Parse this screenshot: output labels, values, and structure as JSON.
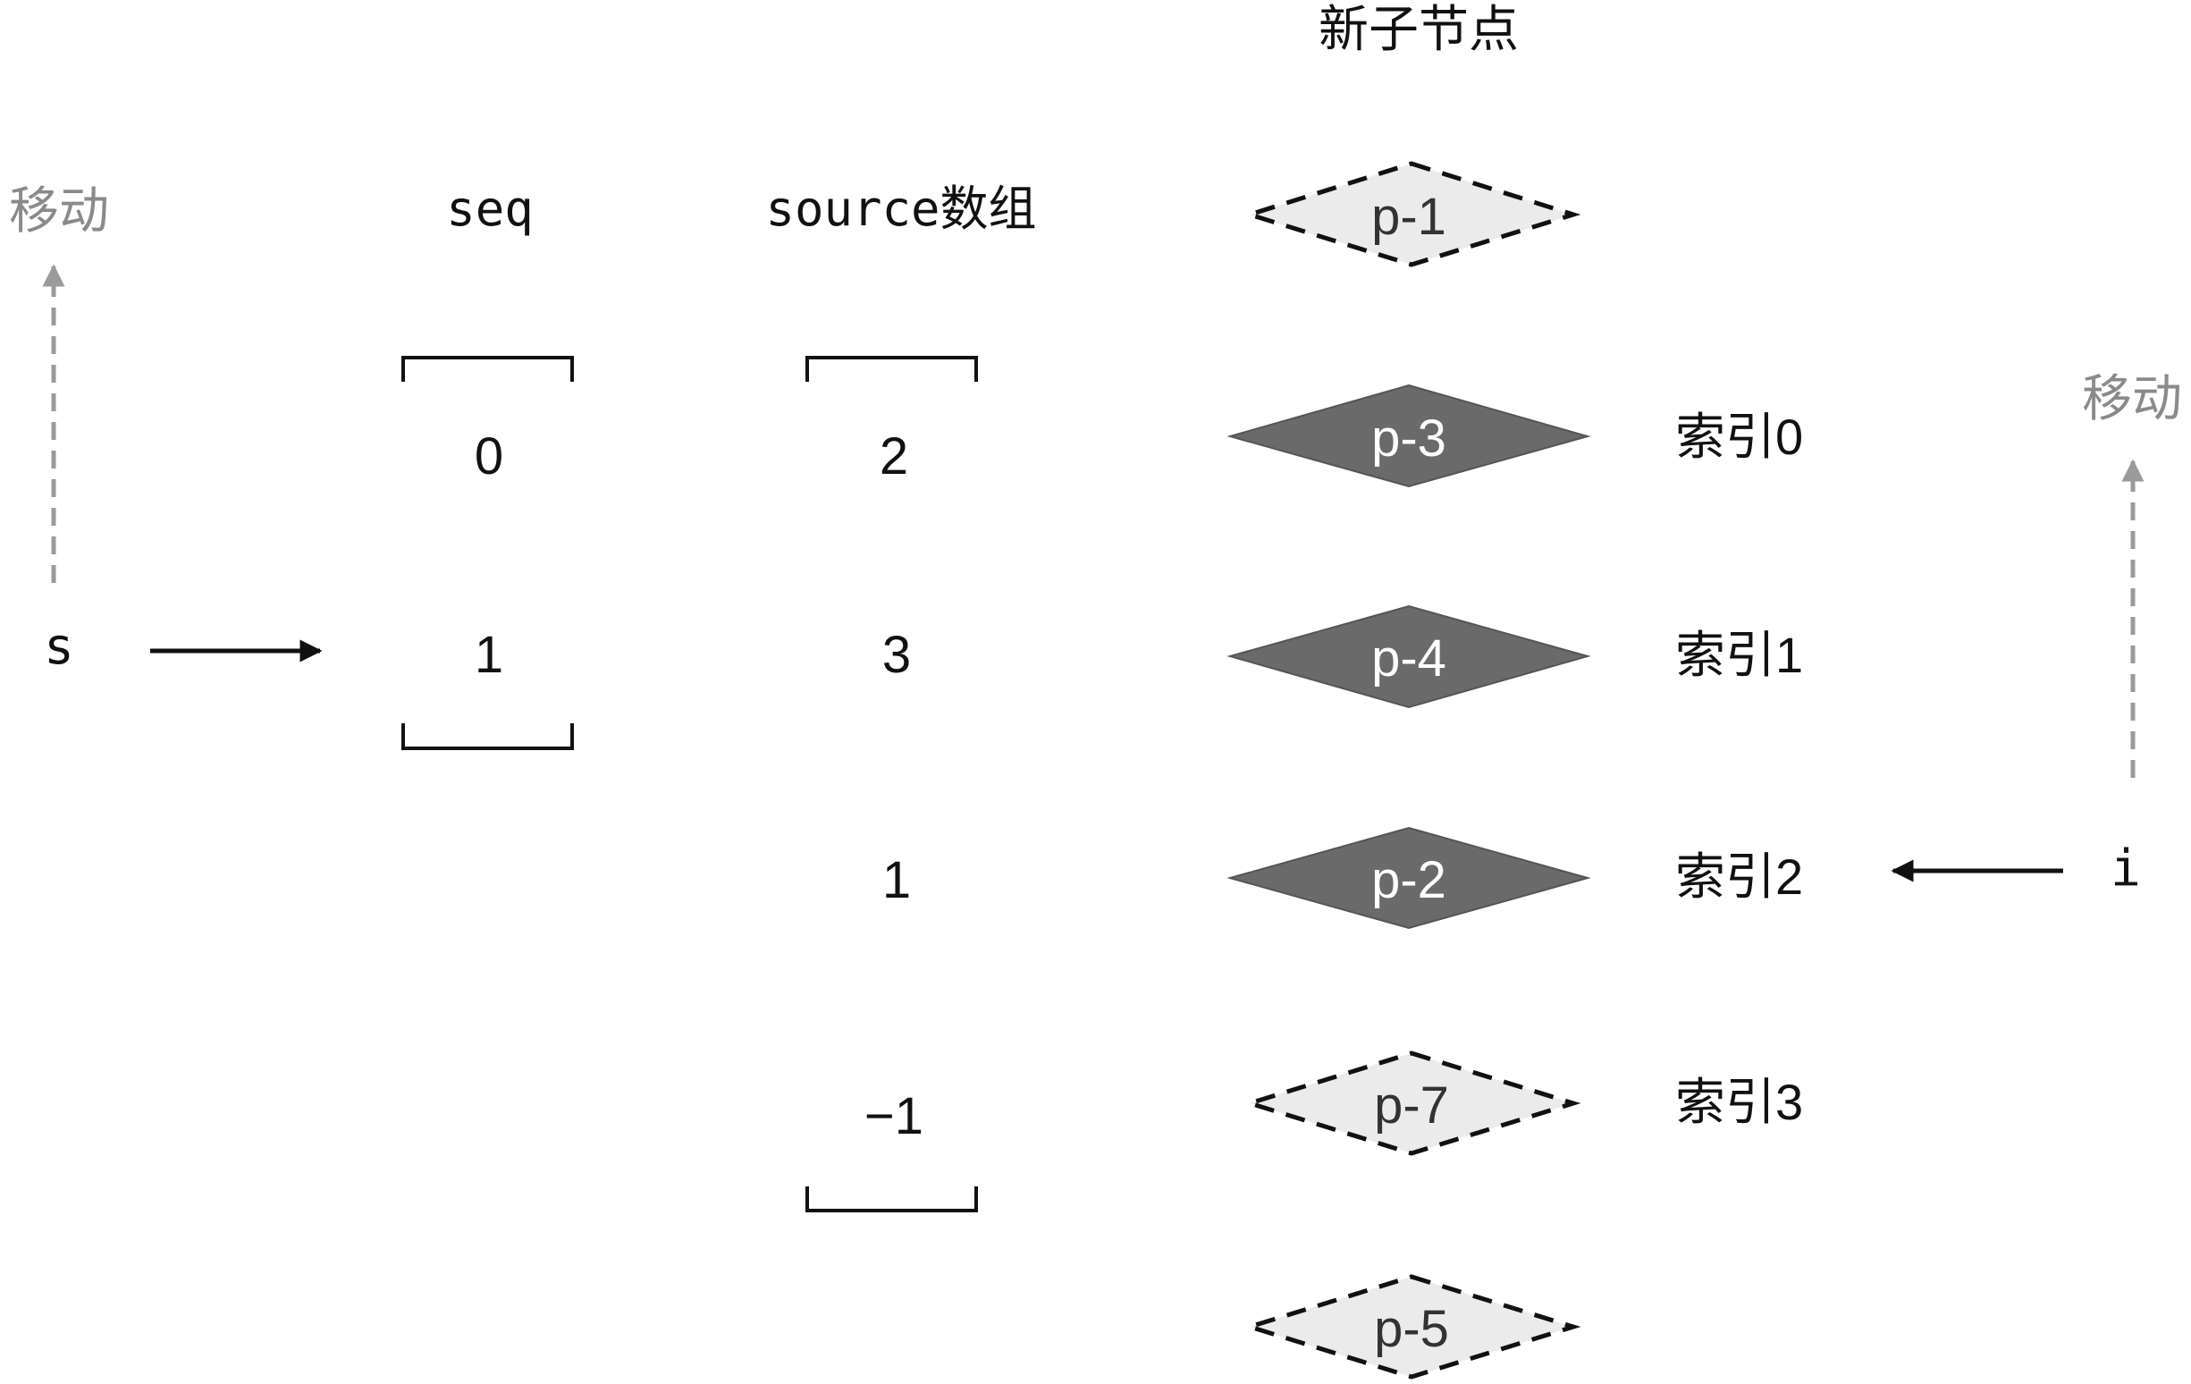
{
  "header": {
    "title": "新子节点"
  },
  "left": {
    "move_label": "移动",
    "pointer_label": "s",
    "seq_title": "seq",
    "seq_values": [
      "0",
      "1"
    ]
  },
  "source": {
    "title": "source数组",
    "values": [
      "2",
      "3",
      "1",
      "−1"
    ]
  },
  "nodes": [
    {
      "label": "p-1",
      "style": "dashed"
    },
    {
      "label": "p-3",
      "style": "solid"
    },
    {
      "label": "p-4",
      "style": "solid"
    },
    {
      "label": "p-2",
      "style": "solid"
    },
    {
      "label": "p-7",
      "style": "dashed"
    },
    {
      "label": "p-5",
      "style": "dashed"
    }
  ],
  "indices": [
    "索引0",
    "索引1",
    "索引2",
    "索引3"
  ],
  "right": {
    "move_label": "移动",
    "pointer_label": "i"
  },
  "colors": {
    "solid_node": "#6a6a6a",
    "dashed_node_fill": "#ebebeb",
    "move_arrow": "#9a9a9a",
    "text": "#111111"
  }
}
